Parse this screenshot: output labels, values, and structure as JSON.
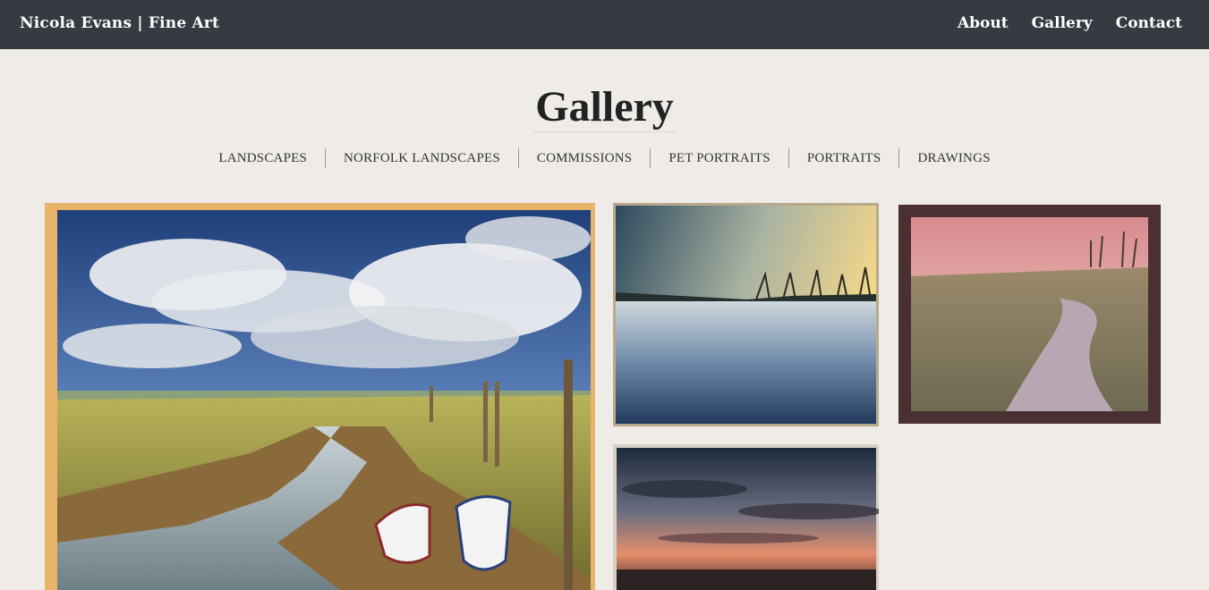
{
  "header": {
    "brand": "Nicola Evans | Fine Art",
    "nav": [
      {
        "label": "About"
      },
      {
        "label": "Gallery"
      },
      {
        "label": "Contact"
      }
    ]
  },
  "page": {
    "title": "Gallery"
  },
  "categories": [
    {
      "label": "LANDSCAPES"
    },
    {
      "label": "NORFOLK LANDSCAPES"
    },
    {
      "label": "COMMISSIONS"
    },
    {
      "label": "PET PORTRAITS"
    },
    {
      "label": "PORTRAITS"
    },
    {
      "label": "DRAWINGS"
    }
  ],
  "gallery": [
    {
      "subject": "marsh-path-with-boats"
    },
    {
      "subject": "lake-reflection-sunset"
    },
    {
      "subject": "framed-river-path"
    },
    {
      "subject": "sunset-sky"
    }
  ],
  "colors": {
    "header_bg": "#363a41",
    "page_bg": "#efece8"
  }
}
